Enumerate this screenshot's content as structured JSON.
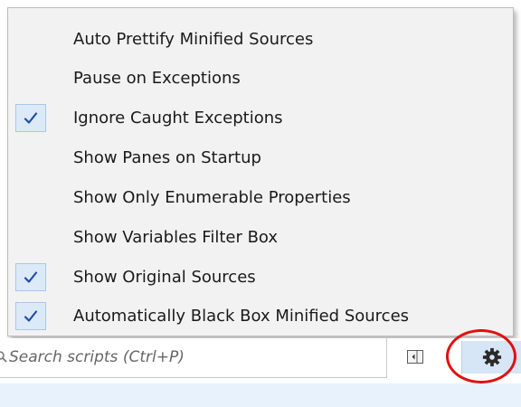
{
  "menu": {
    "items": [
      {
        "label": "Auto Prettify Minified Sources",
        "checked": false
      },
      {
        "label": "Pause on Exceptions",
        "checked": false
      },
      {
        "label": "Ignore Caught Exceptions",
        "checked": true
      },
      {
        "label": "Show Panes on Startup",
        "checked": false
      },
      {
        "label": "Show Only Enumerable Properties",
        "checked": false
      },
      {
        "label": "Show Variables Filter Box",
        "checked": false
      },
      {
        "label": "Show Original Sources",
        "checked": true
      },
      {
        "label": "Automatically Black Box Minified Sources",
        "checked": true
      }
    ]
  },
  "toolbar": {
    "search_placeholder": "Search scripts (Ctrl+P)"
  },
  "icons": {
    "check": "checkmark-icon",
    "search": "magnifier-icon",
    "pane_toggle": "pane-toggle-icon",
    "gear": "gear-icon"
  },
  "colors": {
    "menu_background": "#f2f2f2",
    "check_highlight": "#dceaf8",
    "check_color": "#1f4fa8",
    "gear_highlight": "#d6e6f6",
    "annotation_circle": "#e01010"
  }
}
